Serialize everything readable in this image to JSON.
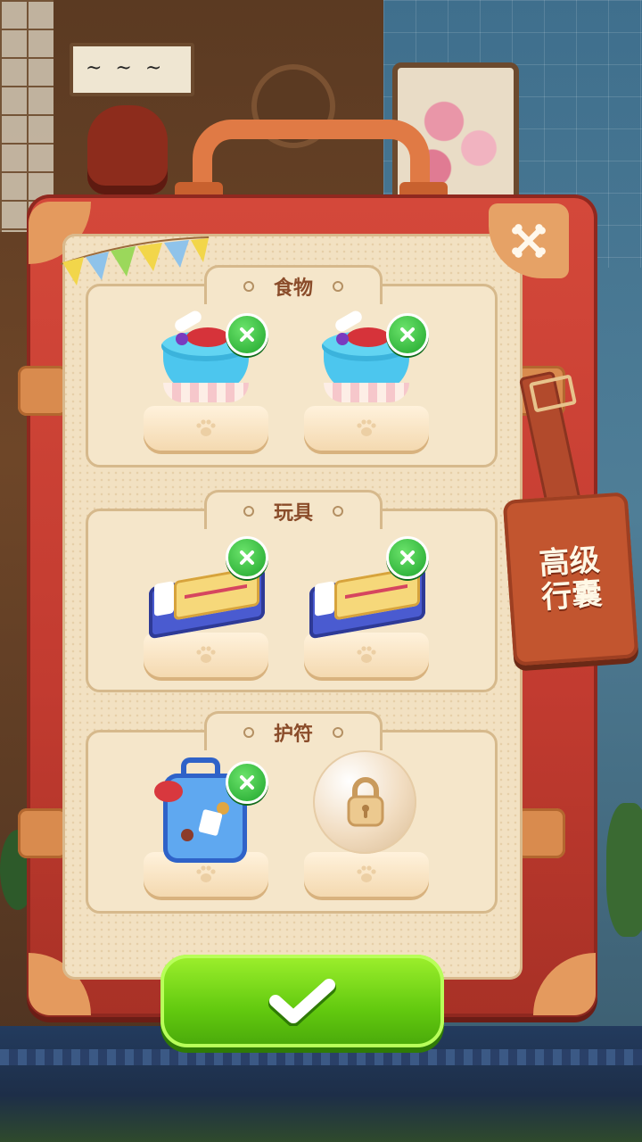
{
  "panel": {
    "tag_label": "高级\n行囊"
  },
  "sections": [
    {
      "title": "食物",
      "slots": [
        {
          "item": "cake",
          "removable": true
        },
        {
          "item": "cake",
          "removable": true
        }
      ]
    },
    {
      "title": "玩具",
      "slots": [
        {
          "item": "ticket",
          "removable": true
        },
        {
          "item": "ticket",
          "removable": true
        }
      ]
    },
    {
      "title": "护符",
      "slots": [
        {
          "item": "suitcase-charm",
          "removable": true
        },
        {
          "item": "locked",
          "removable": false
        }
      ]
    }
  ],
  "icons": {
    "close": "crossed-bones-icon",
    "remove": "x-icon",
    "confirm": "checkmark-icon",
    "lock": "padlock-icon",
    "paw": "paw-icon"
  },
  "colors": {
    "case_red": "#c23b30",
    "confirm_green": "#62c90f",
    "remove_green": "#1fa52c",
    "title_brown": "#8a4c2a"
  }
}
